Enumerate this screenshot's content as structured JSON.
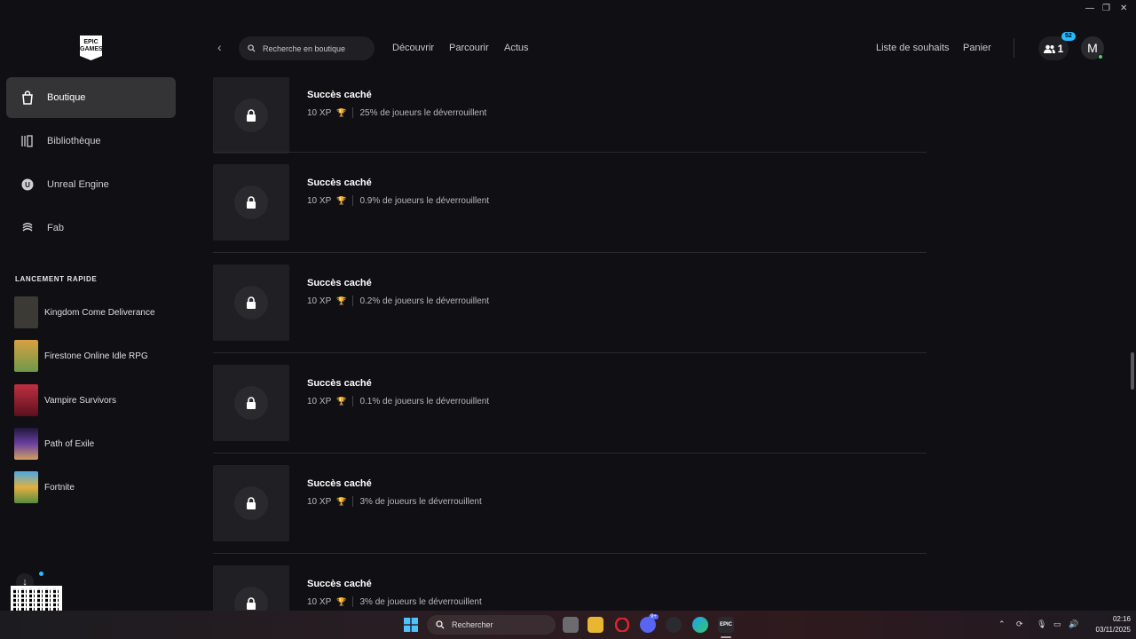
{
  "sidebar": {
    "logo_text": "EPIC GAMES",
    "nav": [
      {
        "label": "Boutique",
        "icon": "shopping-bag-icon",
        "active": true
      },
      {
        "label": "Bibliothèque",
        "icon": "library-icon",
        "active": false
      },
      {
        "label": "Unreal Engine",
        "icon": "unreal-icon",
        "active": false
      },
      {
        "label": "Fab",
        "icon": "fab-icon",
        "active": false
      }
    ],
    "quick_launch_title": "LANCEMENT RAPIDE",
    "quick_launch": [
      {
        "label": "Kingdom Come Deliverance",
        "color": "#3b3a34"
      },
      {
        "label": "Firestone Online Idle RPG",
        "color": "#6e9a4a"
      },
      {
        "label": "Vampire Survivors",
        "color": "#8a2030"
      },
      {
        "label": "Path of Exile",
        "color": "#3a2a55"
      },
      {
        "label": "Fortnite",
        "color": "#3f8fd0"
      }
    ]
  },
  "topbar": {
    "search_placeholder": "Recherche en boutique",
    "links": [
      "Découvrir",
      "Parcourir",
      "Actus"
    ],
    "wishlist": "Liste de souhaits",
    "cart": "Panier",
    "friends_count": "1",
    "friends_badge": "52",
    "avatar_initial": "M"
  },
  "achievements": [
    {
      "name": "Succès caché",
      "xp": "10 XP",
      "percent": "25% de joueurs le déverrouillent"
    },
    {
      "name": "Succès caché",
      "xp": "10 XP",
      "percent": "0.9% de joueurs le déverrouillent"
    },
    {
      "name": "Succès caché",
      "xp": "10 XP",
      "percent": "0.2% de joueurs le déverrouillent"
    },
    {
      "name": "Succès caché",
      "xp": "10 XP",
      "percent": "0.1% de joueurs le déverrouillent"
    },
    {
      "name": "Succès caché",
      "xp": "10 XP",
      "percent": "3% de joueurs le déverrouillent"
    },
    {
      "name": "Succès caché",
      "xp": "10 XP",
      "percent": "3% de joueurs le déverrouillent"
    }
  ],
  "taskbar": {
    "search_label": "Rechercher",
    "time": "02:16",
    "date": "03/11/2025",
    "notification_badge": "9+"
  },
  "colors": {
    "background": "#101014",
    "accent": "#26bbff",
    "trophy": "#c43c3c"
  }
}
